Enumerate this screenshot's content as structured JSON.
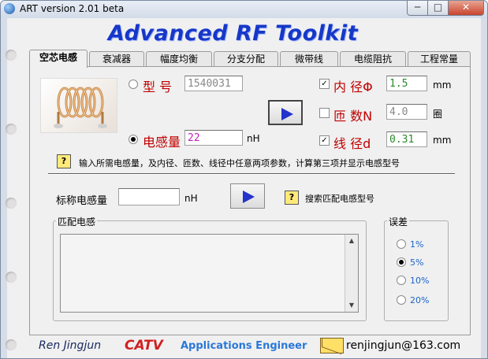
{
  "window": {
    "title": "ART version 2.01 beta"
  },
  "app": {
    "title": "Advanced RF Toolkit"
  },
  "tabs": [
    "空芯电感",
    "衰减器",
    "幅度均衡",
    "分支分配",
    "微带线",
    "电缆阻抗",
    "工程常量"
  ],
  "calc": {
    "model_label": "型  号",
    "model_value": "1540031",
    "inductance_label": "电感量",
    "inductance_value": "22",
    "inductance_unit": "nH",
    "inner_diameter_label": "内  径Φ",
    "inner_diameter_value": "1.5",
    "inner_diameter_unit": "mm",
    "turns_label": "匝  数N",
    "turns_value": "4.0",
    "turns_unit": "圈",
    "wire_diameter_label": "线  径d",
    "wire_diameter_value": "0.31",
    "wire_diameter_unit": "mm",
    "hint": "输入所需电感量，及内径、匝数、线径中任意两项参数，计算第三项并显示电感型号"
  },
  "search": {
    "nominal_label": "标称电感量",
    "nominal_value": "",
    "nominal_unit": "nH",
    "hint": "搜索匹配电感型号"
  },
  "match": {
    "label": "匹配电感"
  },
  "tolerance": {
    "label": "误差",
    "options": [
      "1%",
      "5%",
      "10%",
      "20%"
    ],
    "selected": "5%"
  },
  "footer": {
    "author": "Ren Jingjun",
    "brand": "CATV",
    "role": "Applications Engineer",
    "email": "renjingjun@163.com"
  },
  "colors": {
    "title_blue": "#1638c8",
    "label_red": "#c00000",
    "link_blue": "#1a64c8"
  }
}
